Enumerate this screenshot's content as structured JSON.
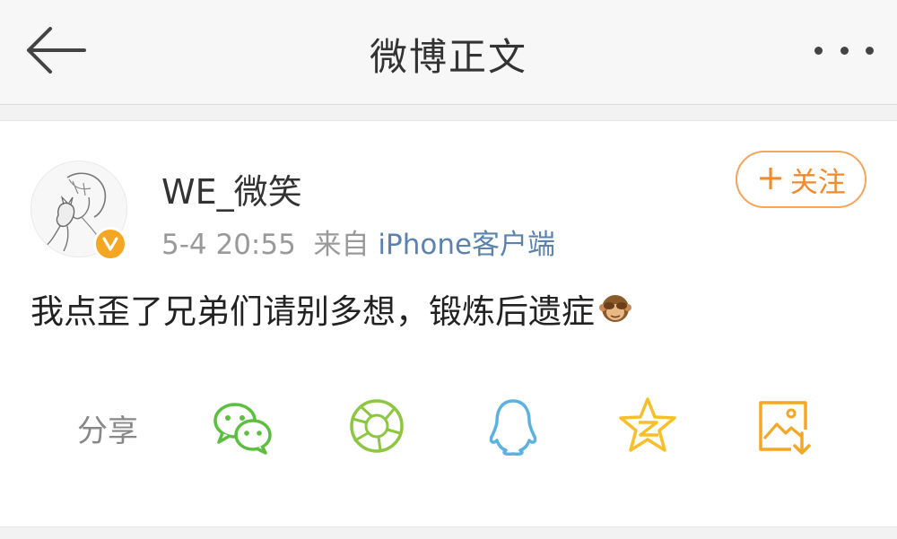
{
  "nav": {
    "title": "微博正文"
  },
  "post": {
    "username": "WE_微笑",
    "time": "5-4 20:55",
    "source_prefix": "来自",
    "source": "iPhone客户端",
    "follow_label": "关注",
    "follow_plus": "+",
    "text": "我点歪了兄弟们请别多想，锻炼后遗症"
  },
  "share": {
    "label": "分享",
    "targets": [
      "wechat-icon",
      "moments-icon",
      "qq-icon",
      "qzone-icon",
      "save-image-icon"
    ]
  },
  "colors": {
    "accent_orange": "#f28a2c",
    "wechat_green": "#5cbf3f",
    "moments_green": "#8dc63f",
    "qq_blue": "#5bb2e0",
    "qzone_yellow": "#f7c02a",
    "save_orange": "#f5a623",
    "link_blue": "#5b83ae"
  }
}
